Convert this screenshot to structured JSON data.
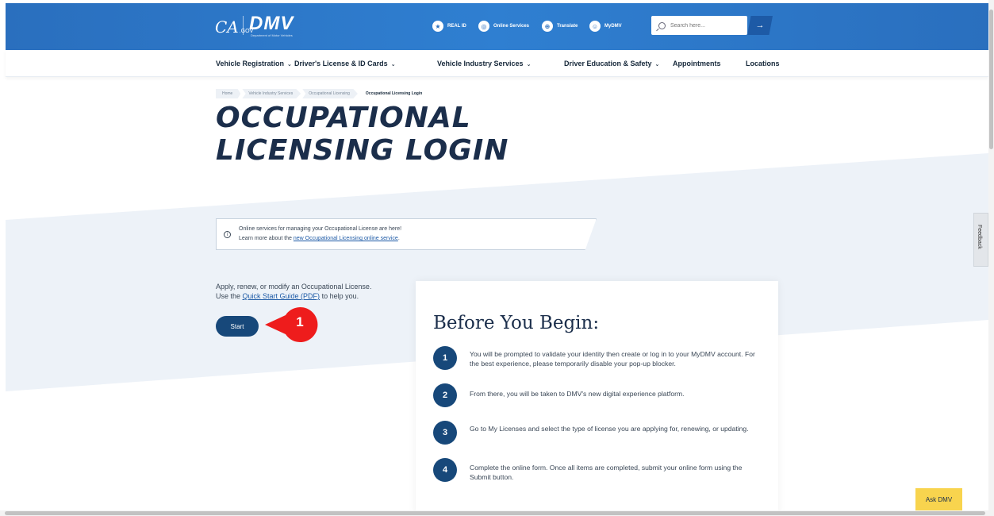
{
  "header": {
    "ca_logo": "CA",
    "ca_logo_suffix": ".GOV",
    "dmv_logo": "DMV",
    "dmv_logo_sub": "Department of Motor Vehicles",
    "links": [
      {
        "label": "REAL ID",
        "icon": "star-icon"
      },
      {
        "label": "Online Services",
        "icon": "globe-icon"
      },
      {
        "label": "Translate",
        "icon": "translate-icon"
      },
      {
        "label": "MyDMV",
        "icon": "user-icon"
      }
    ],
    "search_placeholder": "Search here...",
    "search_button": "→",
    "brand_color": "#2a6fbe"
  },
  "nav": {
    "items": [
      {
        "label": "Vehicle Registration",
        "has_dropdown": true
      },
      {
        "label": "Driver's License & ID Cards",
        "has_dropdown": true
      },
      {
        "label": "Vehicle Industry Services",
        "has_dropdown": true
      },
      {
        "label": "Driver Education & Safety",
        "has_dropdown": true
      },
      {
        "label": "Appointments",
        "has_dropdown": false
      },
      {
        "label": "Locations",
        "has_dropdown": false
      }
    ]
  },
  "breadcrumb": [
    "Home",
    "Vehicle Industry Services",
    "Occupational Licensing",
    "Occupational Licensing Login"
  ],
  "page_title_line1": "OCCUPATIONAL",
  "page_title_line2": "LICENSING LOGIN",
  "info_banner": {
    "line1": "Online services for managing your Occupational License are here!",
    "line2_prefix": "Learn more about the ",
    "line2_link": "new Occupational Licensing online service",
    "line2_suffix": "."
  },
  "apply": {
    "line1": "Apply, renew, or modify an Occupational License.",
    "line2_prefix": "Use the ",
    "line2_link": "Quick Start Guide (PDF)",
    "line2_suffix": " to help you."
  },
  "start_button": "Start",
  "annotation_marker": "1",
  "before_you_begin": {
    "title": "Before You Begin:",
    "steps": [
      {
        "num": "1",
        "text": "You will be prompted to validate your identity then create or log in to your MyDMV account. For the best experience, please temporarily disable your pop-up blocker."
      },
      {
        "num": "2",
        "text": "From there, you will be taken to DMV's new digital experience platform."
      },
      {
        "num": "3",
        "text": "Go to My Licenses and select the type of license you are applying for, renewing, or updating."
      },
      {
        "num": "4",
        "text": "Complete the online form. Once all items are completed, submit your online form using the Submit button."
      }
    ]
  },
  "feedback_tab": "Feedback",
  "ask_dmv": "Ask DMV"
}
